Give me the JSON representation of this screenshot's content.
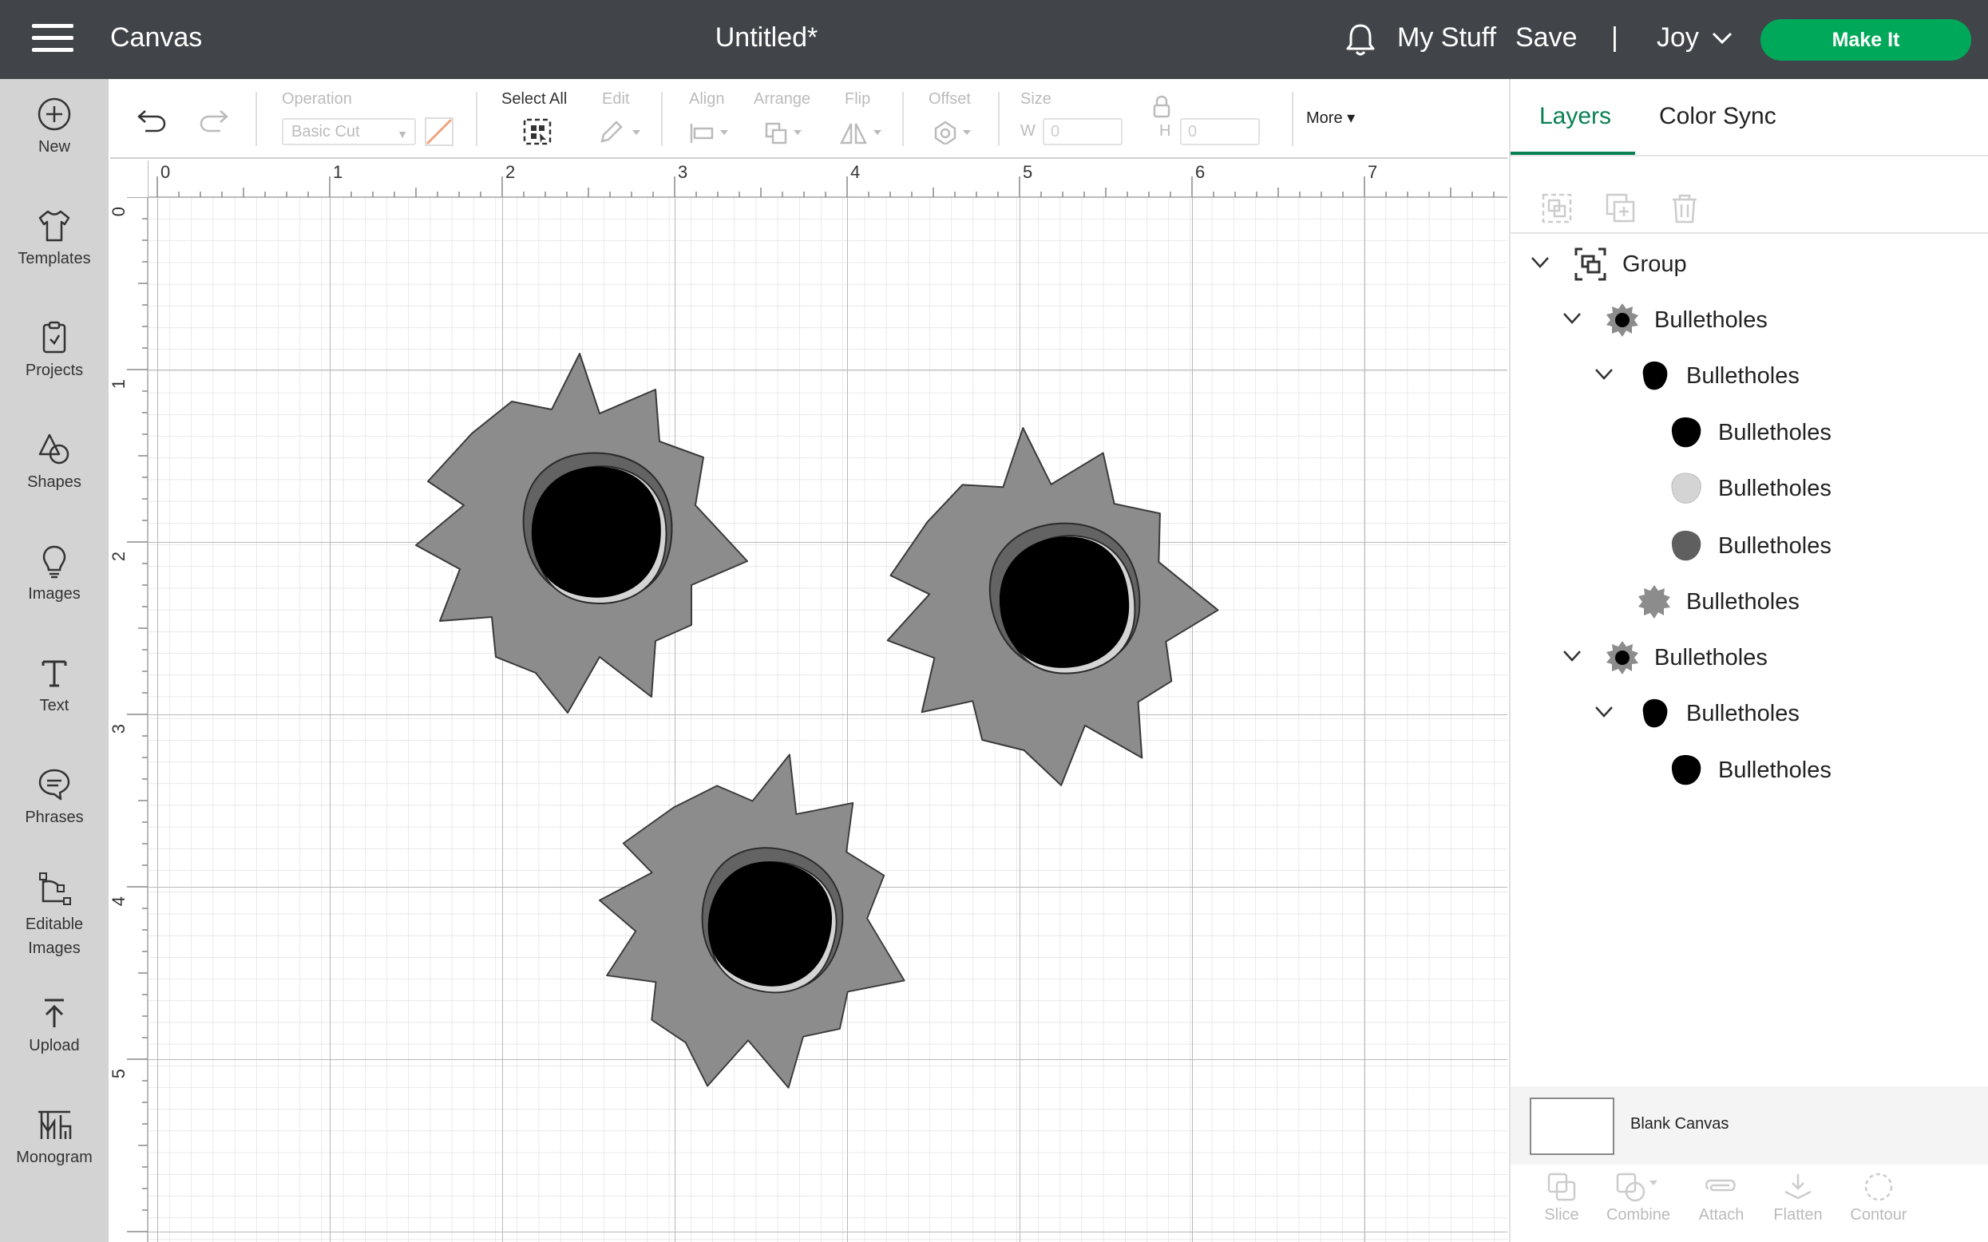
{
  "topbar": {
    "app_title": "Canvas",
    "doc_title": "Untitled*",
    "my_stuff": "My Stuff",
    "save": "Save",
    "divider": "|",
    "user": "Joy",
    "make_it": "Make It"
  },
  "sidebar": {
    "items": [
      {
        "label": "New",
        "icon": "plus-circle-icon"
      },
      {
        "label": "Templates",
        "icon": "tshirt-icon"
      },
      {
        "label": "Projects",
        "icon": "clipboard-icon"
      },
      {
        "label": "Shapes",
        "icon": "shapes-icon"
      },
      {
        "label": "Images",
        "icon": "lightbulb-icon"
      },
      {
        "label": "Text",
        "icon": "text-icon"
      },
      {
        "label": "Phrases",
        "icon": "speech-bubble-icon"
      },
      {
        "label": "Editable Images",
        "icon": "vector-edit-icon"
      },
      {
        "label": "Upload",
        "icon": "upload-icon"
      },
      {
        "label": "Monogram",
        "icon": "monogram-icon"
      }
    ]
  },
  "toolbar": {
    "operation_label": "Operation",
    "operation_value": "Basic Cut",
    "select_all": "Select All",
    "edit": "Edit",
    "align": "Align",
    "arrange": "Arrange",
    "flip": "Flip",
    "offset": "Offset",
    "size": "Size",
    "w_label": "W",
    "h_label": "H",
    "w_value": "0",
    "h_value": "0",
    "more": "More ▾"
  },
  "canvas": {
    "ruler_top": [
      "0",
      "1",
      "2",
      "3",
      "4",
      "5",
      "6",
      "7"
    ],
    "ruler_left": [
      "0",
      "1",
      "2",
      "3",
      "4",
      "5"
    ],
    "bg_color": "#ffffff",
    "grid_color": "#d8d8d8",
    "shape_fill": "#8c8c8c",
    "hole_fill": "#000000",
    "inner_shade": "#636363",
    "highlight": "#d4d4d4"
  },
  "panel": {
    "tabs": [
      "Layers",
      "Color Sync"
    ],
    "accent": "#0a7f52",
    "layers": [
      {
        "name": "Group",
        "indent": 0,
        "chevron": true,
        "thumb": "group-icon"
      },
      {
        "name": "Bulletholes",
        "indent": 1,
        "chevron": true,
        "thumb": "bullethole-icon"
      },
      {
        "name": "Bulletholes",
        "indent": 2,
        "chevron": true,
        "thumb": "black-blob-icon"
      },
      {
        "name": "Bulletholes",
        "indent": 3,
        "chevron": false,
        "thumb": "black-blob-icon"
      },
      {
        "name": "Bulletholes",
        "indent": 3,
        "chevron": false,
        "thumb": "light-gray-blob-icon"
      },
      {
        "name": "Bulletholes",
        "indent": 3,
        "chevron": false,
        "thumb": "dark-gray-blob-icon"
      },
      {
        "name": "Bulletholes",
        "indent": 2,
        "chevron": false,
        "thumb": "gray-splat-icon"
      },
      {
        "name": "Bulletholes",
        "indent": 1,
        "chevron": true,
        "thumb": "bullethole-icon"
      },
      {
        "name": "Bulletholes",
        "indent": 2,
        "chevron": true,
        "thumb": "black-blob-icon"
      },
      {
        "name": "Bulletholes",
        "indent": 3,
        "chevron": false,
        "thumb": "black-blob-icon"
      }
    ],
    "blank_canvas": "Blank Canvas",
    "bottom_tools": [
      "Slice",
      "Combine",
      "Attach",
      "Flatten",
      "Contour"
    ]
  }
}
